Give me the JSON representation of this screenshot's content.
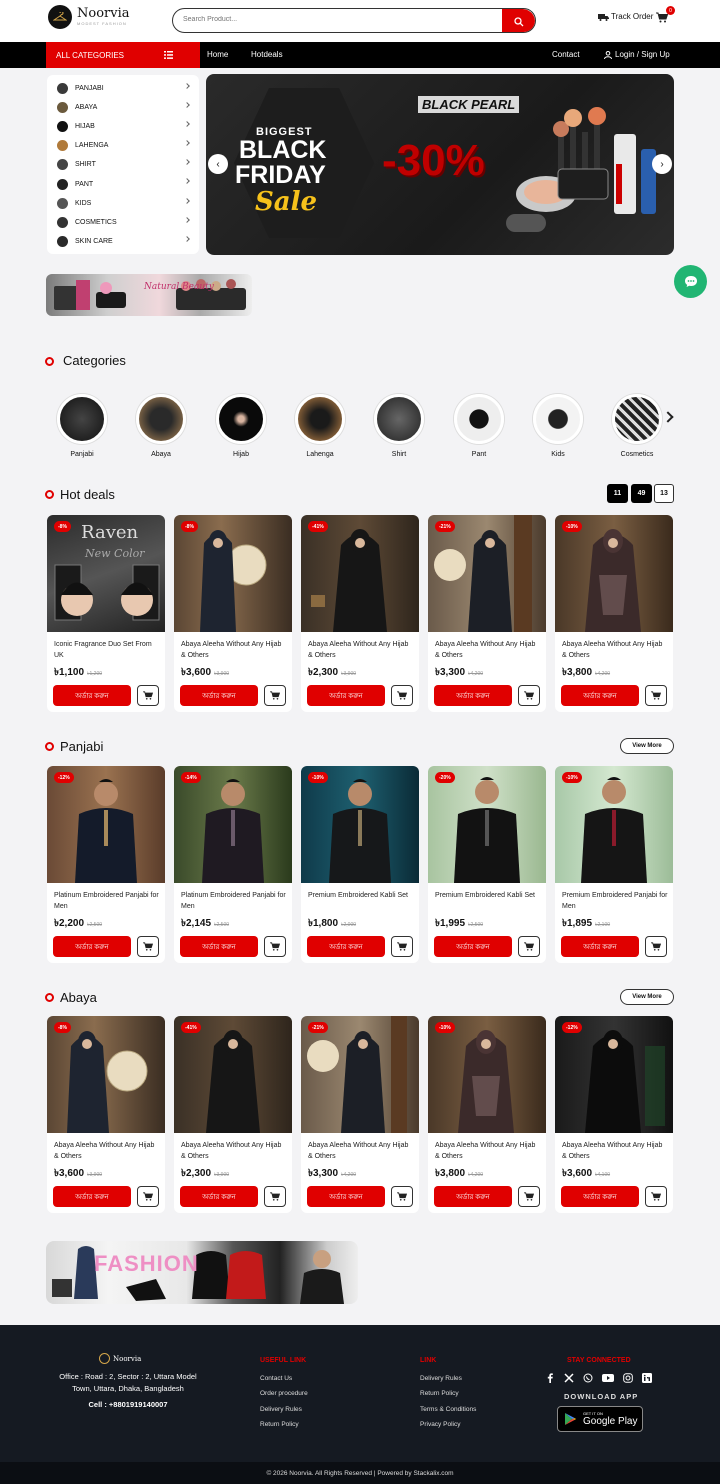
{
  "header": {
    "brand": "Noorvia",
    "tagline": "MODEST FASHION",
    "search_placeholder": "Search Product...",
    "track_order": "Track Order",
    "cart_count": "0"
  },
  "nav": {
    "all_categories": "ALL CATEGORIES",
    "links": [
      "Home",
      "Hotdeals"
    ],
    "contact": "Contact",
    "login": "Login / Sign Up"
  },
  "sidebar": {
    "items": [
      "PANJABI",
      "ABAYA",
      "HIJAB",
      "LAHENGA",
      "SHIRT",
      "PANT",
      "KIDS",
      "COSMETICS",
      "SKIN CARE"
    ]
  },
  "hero": {
    "line1": "BIGGEST",
    "line2": "BLACK",
    "line3": "FRIDAY",
    "line4": "Sale",
    "brand": "BLACK PEARL",
    "discount": "-30%"
  },
  "promo1": {
    "text": "Natural Beauty"
  },
  "categories": {
    "title": "Categories",
    "items": [
      "Panjabi",
      "Abaya",
      "Hijab",
      "Lahenga",
      "Shirt",
      "Pant",
      "Kids",
      "Cosmetics"
    ]
  },
  "hot_deals": {
    "title": "Hot deals",
    "timer": [
      "11",
      "49",
      "13"
    ],
    "products": [
      {
        "badge": "-8%",
        "title": "Iconic Fragrance Duo Set From UK",
        "price": "৳1,100",
        "old": "৳1,200"
      },
      {
        "badge": "-8%",
        "title": "Abaya Aleeha Without Any Hijab & Others",
        "price": "৳3,600",
        "old": "৳3,900"
      },
      {
        "badge": "-41%",
        "title": "Abaya Aleeha Without Any Hijab & Others",
        "price": "৳2,300",
        "old": "৳3,900"
      },
      {
        "badge": "-21%",
        "title": "Abaya Aleeha Without Any Hijab & Others",
        "price": "৳3,300",
        "old": "৳4,200"
      },
      {
        "badge": "-10%",
        "title": "Abaya Aleeha Without Any Hijab & Others",
        "price": "৳3,800",
        "old": "৳4,200"
      }
    ]
  },
  "panjabi": {
    "title": "Panjabi",
    "view_more": "View More",
    "products": [
      {
        "badge": "-12%",
        "title": "Platinum Embroidered Panjabi for Men",
        "price": "৳2,200",
        "old": "৳2,500"
      },
      {
        "badge": "-14%",
        "title": "Platinum Embroidered Panjabi for Men",
        "price": "৳2,145",
        "old": "৳2,500"
      },
      {
        "badge": "-10%",
        "title": "Premium Embroidered Kabli Set",
        "price": "৳1,800",
        "old": "৳2,000"
      },
      {
        "badge": "-20%",
        "title": "Premium Embroidered Kabli Set",
        "price": "৳1,995",
        "old": "৳2,500"
      },
      {
        "badge": "-10%",
        "title": "Premium Embroidered Panjabi for Men",
        "price": "৳1,895",
        "old": "৳2,100"
      }
    ]
  },
  "abaya": {
    "title": "Abaya",
    "view_more": "View More",
    "products": [
      {
        "badge": "-8%",
        "title": "Abaya Aleeha Without Any Hijab & Others",
        "price": "৳3,600",
        "old": "৳3,900"
      },
      {
        "badge": "-41%",
        "title": "Abaya Aleeha Without Any Hijab & Others",
        "price": "৳2,300",
        "old": "৳3,900"
      },
      {
        "badge": "-21%",
        "title": "Abaya Aleeha Without Any Hijab & Others",
        "price": "৳3,300",
        "old": "৳4,200"
      },
      {
        "badge": "-10%",
        "title": "Abaya Aleeha Without Any Hijab & Others",
        "price": "৳3,800",
        "old": "৳4,200"
      },
      {
        "badge": "-12%",
        "title": "Abaya Aleeha Without Any Hijab & Others",
        "price": "৳3,600",
        "old": "৳4,100"
      }
    ]
  },
  "order_label": "অর্ডার করুন",
  "promo2": {
    "text": "FASHION"
  },
  "footer": {
    "brand": "Noorvia",
    "office": "Office : Road : 2, Sector : 2, Uttara Model Town, Uttara, Dhaka, Bangladesh",
    "cell": "Cell : +8801919140007",
    "useful_link_title": "USEFUL LINK",
    "useful_links": [
      "Contact Us",
      "Order procedure",
      "Delivery Rules",
      "Return Policy"
    ],
    "link_title": "LINK",
    "links": [
      "Delivery Rules",
      "Return Policy",
      "Terms & Conditions",
      "Privacy Policy"
    ],
    "stay_connected": "STAY CONNECTED",
    "download_app": "DOWNLOAD APP",
    "get_it_on": "GET IT ON",
    "google_play": "Google Play",
    "copyright": "© 2026 Noorvia. All Rights Reserved | Powered by Stackalix.com"
  },
  "colors": {
    "accent": "#e00000",
    "nav": "#000000",
    "footer": "#151a22"
  }
}
